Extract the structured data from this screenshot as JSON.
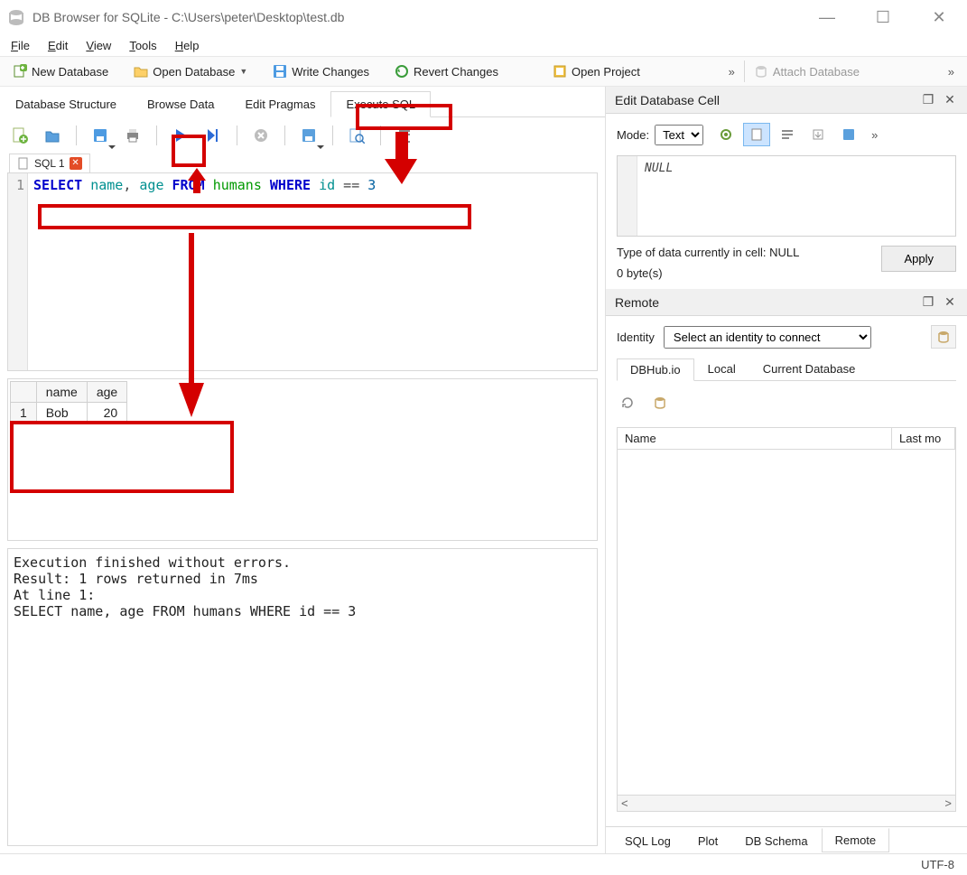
{
  "window": {
    "title": "DB Browser for SQLite - C:\\Users\\peter\\Desktop\\test.db"
  },
  "menu": {
    "file": "File",
    "edit": "Edit",
    "view": "View",
    "tools": "Tools",
    "help": "Help"
  },
  "toolbar": {
    "new_db": "New Database",
    "open_db": "Open Database",
    "write": "Write Changes",
    "revert": "Revert Changes",
    "open_project": "Open Project",
    "attach": "Attach Database"
  },
  "tabs": {
    "db_structure": "Database Structure",
    "browse_data": "Browse Data",
    "edit_pragmas": "Edit Pragmas",
    "execute_sql": "Execute SQL"
  },
  "sql_tab": {
    "name": "SQL 1"
  },
  "editor": {
    "line_no": "1",
    "tokens": [
      "SELECT",
      " ",
      "name",
      ", ",
      "age",
      " ",
      "FROM",
      " ",
      "humans",
      " ",
      "WHERE",
      " ",
      "id",
      " == ",
      "3"
    ]
  },
  "result": {
    "columns": [
      "name",
      "age"
    ],
    "rows": [
      [
        "Bob",
        "20"
      ]
    ]
  },
  "log": "Execution finished without errors.\nResult: 1 rows returned in 7ms\nAt line 1:\nSELECT name, age FROM humans WHERE id == 3",
  "editcell": {
    "title": "Edit Database Cell",
    "mode_label": "Mode:",
    "mode_value": "Text",
    "cell_value": "NULL",
    "type_text": "Type of data currently in cell: NULL",
    "size_text": "0 byte(s)",
    "apply": "Apply"
  },
  "remote": {
    "title": "Remote",
    "identity_label": "Identity",
    "identity_value": "Select an identity to connect",
    "tabs": {
      "dbhub": "DBHub.io",
      "local": "Local",
      "current": "Current Database"
    },
    "cols": {
      "name": "Name",
      "last": "Last mo"
    }
  },
  "bottom_tabs": {
    "sql_log": "SQL Log",
    "plot": "Plot",
    "db_schema": "DB Schema",
    "remote": "Remote"
  },
  "status": {
    "encoding": "UTF-8"
  }
}
